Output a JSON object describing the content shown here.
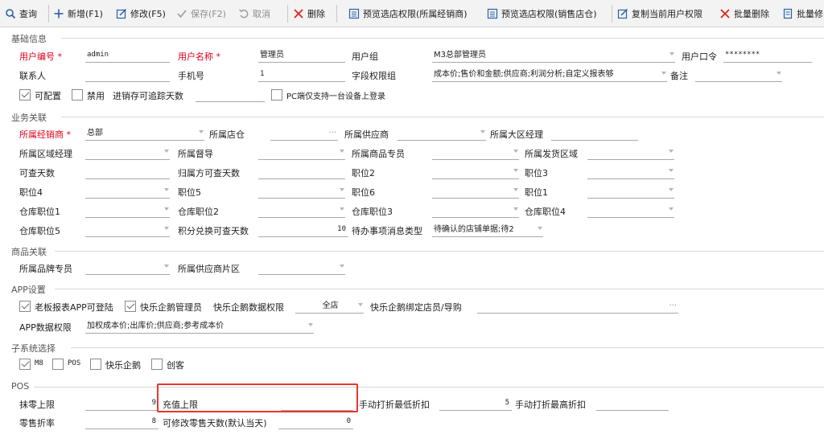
{
  "toolbar": {
    "query": "查询",
    "add": "新增(F1)",
    "edit": "修改(F5)",
    "save": "保存(F2)",
    "cancel": "取消",
    "delete": "删除",
    "preview_dealer": "预览选店权限(所属经销商)",
    "preview_store": "预览选店权限(销售店仓)",
    "copy_perm": "复制当前用户权限",
    "batch_delete": "批量删除",
    "batch_edit": "批量修"
  },
  "colors": {
    "required": "#e0001b",
    "highlight": "#e8362f",
    "save_disabled": "#8c8c8c"
  },
  "icons": {
    "query": "search-icon",
    "add": "plus-icon",
    "edit": "edit-icon",
    "save": "check-icon",
    "cancel": "undo-icon",
    "delete": "close-icon",
    "preview": "grid-icon",
    "copy": "edit-icon",
    "batch_delete": "close-icon",
    "batch_edit": "document-icon"
  },
  "sections": {
    "basic": "基础信息",
    "business": "业务关联",
    "product": "商品关联",
    "app": "APP设置",
    "subsystem": "子系统选择",
    "pos": "POS"
  },
  "basic": {
    "user_code_label": "用户编号",
    "user_code": "admin",
    "user_name_label": "用户名称",
    "user_name": "管理员",
    "user_group_label": "用户组",
    "user_group": "M3总部管理员",
    "password_label": "用户口令",
    "password": "********",
    "contact_label": "联系人",
    "contact": "",
    "mobile_label": "手机号",
    "mobile": "1",
    "field_perm_label": "字段权限组",
    "field_perm": "成本价;售价和金额;供应商;利润分析;自定义报表够",
    "remark_label": "备注",
    "remark": "",
    "configurable_label": "可配置",
    "disabled_label": "禁用",
    "trace_days_label": "进销存可追踪天数",
    "trace_days": "",
    "pc_single_label": "PC端仅支持一台设备上登录",
    "star": "*"
  },
  "business": {
    "dealer_label": "所属经销商",
    "dealer": "总部",
    "store_label": "所属店仓",
    "supplier_label": "所属供应商",
    "region_mgr_label": "所属大区经理",
    "area_mgr_label": "所属区域经理",
    "supervisor_label": "所属督导",
    "product_specialist_label": "所属商品专员",
    "ship_area_label": "所属发货区域",
    "query_days_label": "可查天数",
    "owner_query_days_label": "归属方可查天数",
    "pos2_label": "职位2",
    "pos3_label": "职位3",
    "pos4_label": "职位4",
    "pos5_label": "职位5",
    "pos6_label": "职位6",
    "pos1_label": "职位1",
    "wh1_label": "仓库职位1",
    "wh2_label": "仓库职位2",
    "wh3_label": "仓库职位3",
    "wh4_label": "仓库职位4",
    "wh5_label": "仓库职位5",
    "points_days_label": "积分兑换可查天数",
    "points_days": "10",
    "todo_type_label": "待办事项消息类型",
    "todo_type": "待确认的店铺单据;待2"
  },
  "product": {
    "brand_specialist_label": "所属品牌专员",
    "supplier_area_label": "所属供应商片区"
  },
  "app": {
    "boss_report_label": "老板报表APP可登陆",
    "penguin_admin_label": "快乐企鹅管理员",
    "penguin_data_perm_label": "快乐企鹅数据权限",
    "penguin_data_perm": "全店",
    "penguin_bind_label": "快乐企鹅绑定店员/导购",
    "app_data_perm_label": "APP数据权限",
    "app_data_perm": "加权成本价;出库价;供应商;参考成本价"
  },
  "subsystem": {
    "m8": "M8",
    "pos": "POS",
    "penguin": "快乐企鹅",
    "chuangke": "创客"
  },
  "pos": {
    "zero_limit_label": "抹零上限",
    "zero_limit": "9",
    "recharge_limit_label": "充值上限",
    "recharge_limit": "",
    "min_discount_label": "手动打折最低折扣",
    "min_discount": "5",
    "max_discount_label": "手动打折最高折扣",
    "max_discount": "",
    "retail_discount_label": "零售折率",
    "retail_discount": "8",
    "modify_days_label": "可修改零售天数(默认当天)",
    "modify_days": "0"
  }
}
